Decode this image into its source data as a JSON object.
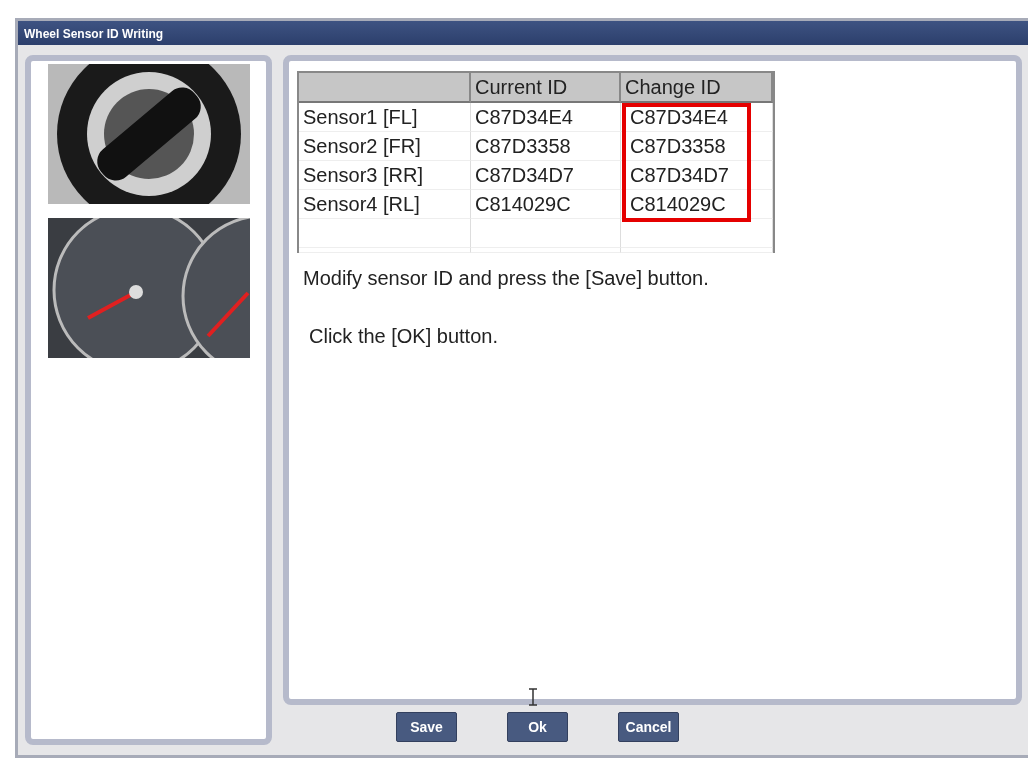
{
  "window": {
    "title": "Wheel Sensor ID Writing"
  },
  "table": {
    "columns": [
      "",
      "Current ID",
      "Change ID"
    ],
    "highlight_change_id": true,
    "rows": [
      [
        "Sensor1 [FL]",
        "C87D34E4",
        "C87D34E4"
      ],
      [
        "Sensor2 [FR]",
        "C87D3358",
        "C87D3358"
      ],
      [
        "Sensor3 [RR]",
        "C87D34D7",
        "C87D34D7"
      ],
      [
        "Sensor4 [RL]",
        "C814029C",
        "C814029C"
      ]
    ]
  },
  "messages": [
    "Modify sensor ID and press the [Save] button.",
    "Click the [OK] button."
  ],
  "buttons": [
    "Save",
    "Ok",
    "Cancel"
  ]
}
